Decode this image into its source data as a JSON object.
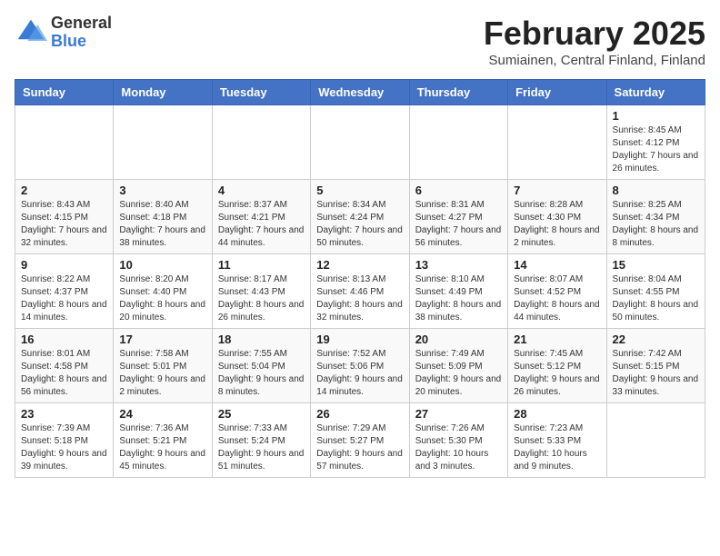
{
  "header": {
    "logo_general": "General",
    "logo_blue": "Blue",
    "month_title": "February 2025",
    "location": "Sumiainen, Central Finland, Finland"
  },
  "weekdays": [
    "Sunday",
    "Monday",
    "Tuesday",
    "Wednesday",
    "Thursday",
    "Friday",
    "Saturday"
  ],
  "weeks": [
    [
      null,
      null,
      null,
      null,
      null,
      null,
      {
        "day": "1",
        "sunrise": "Sunrise: 8:45 AM",
        "sunset": "Sunset: 4:12 PM",
        "daylight": "Daylight: 7 hours and 26 minutes."
      }
    ],
    [
      {
        "day": "2",
        "sunrise": "Sunrise: 8:43 AM",
        "sunset": "Sunset: 4:15 PM",
        "daylight": "Daylight: 7 hours and 32 minutes."
      },
      {
        "day": "3",
        "sunrise": "Sunrise: 8:40 AM",
        "sunset": "Sunset: 4:18 PM",
        "daylight": "Daylight: 7 hours and 38 minutes."
      },
      {
        "day": "4",
        "sunrise": "Sunrise: 8:37 AM",
        "sunset": "Sunset: 4:21 PM",
        "daylight": "Daylight: 7 hours and 44 minutes."
      },
      {
        "day": "5",
        "sunrise": "Sunrise: 8:34 AM",
        "sunset": "Sunset: 4:24 PM",
        "daylight": "Daylight: 7 hours and 50 minutes."
      },
      {
        "day": "6",
        "sunrise": "Sunrise: 8:31 AM",
        "sunset": "Sunset: 4:27 PM",
        "daylight": "Daylight: 7 hours and 56 minutes."
      },
      {
        "day": "7",
        "sunrise": "Sunrise: 8:28 AM",
        "sunset": "Sunset: 4:30 PM",
        "daylight": "Daylight: 8 hours and 2 minutes."
      },
      {
        "day": "8",
        "sunrise": "Sunrise: 8:25 AM",
        "sunset": "Sunset: 4:34 PM",
        "daylight": "Daylight: 8 hours and 8 minutes."
      }
    ],
    [
      {
        "day": "9",
        "sunrise": "Sunrise: 8:22 AM",
        "sunset": "Sunset: 4:37 PM",
        "daylight": "Daylight: 8 hours and 14 minutes."
      },
      {
        "day": "10",
        "sunrise": "Sunrise: 8:20 AM",
        "sunset": "Sunset: 4:40 PM",
        "daylight": "Daylight: 8 hours and 20 minutes."
      },
      {
        "day": "11",
        "sunrise": "Sunrise: 8:17 AM",
        "sunset": "Sunset: 4:43 PM",
        "daylight": "Daylight: 8 hours and 26 minutes."
      },
      {
        "day": "12",
        "sunrise": "Sunrise: 8:13 AM",
        "sunset": "Sunset: 4:46 PM",
        "daylight": "Daylight: 8 hours and 32 minutes."
      },
      {
        "day": "13",
        "sunrise": "Sunrise: 8:10 AM",
        "sunset": "Sunset: 4:49 PM",
        "daylight": "Daylight: 8 hours and 38 minutes."
      },
      {
        "day": "14",
        "sunrise": "Sunrise: 8:07 AM",
        "sunset": "Sunset: 4:52 PM",
        "daylight": "Daylight: 8 hours and 44 minutes."
      },
      {
        "day": "15",
        "sunrise": "Sunrise: 8:04 AM",
        "sunset": "Sunset: 4:55 PM",
        "daylight": "Daylight: 8 hours and 50 minutes."
      }
    ],
    [
      {
        "day": "16",
        "sunrise": "Sunrise: 8:01 AM",
        "sunset": "Sunset: 4:58 PM",
        "daylight": "Daylight: 8 hours and 56 minutes."
      },
      {
        "day": "17",
        "sunrise": "Sunrise: 7:58 AM",
        "sunset": "Sunset: 5:01 PM",
        "daylight": "Daylight: 9 hours and 2 minutes."
      },
      {
        "day": "18",
        "sunrise": "Sunrise: 7:55 AM",
        "sunset": "Sunset: 5:04 PM",
        "daylight": "Daylight: 9 hours and 8 minutes."
      },
      {
        "day": "19",
        "sunrise": "Sunrise: 7:52 AM",
        "sunset": "Sunset: 5:06 PM",
        "daylight": "Daylight: 9 hours and 14 minutes."
      },
      {
        "day": "20",
        "sunrise": "Sunrise: 7:49 AM",
        "sunset": "Sunset: 5:09 PM",
        "daylight": "Daylight: 9 hours and 20 minutes."
      },
      {
        "day": "21",
        "sunrise": "Sunrise: 7:45 AM",
        "sunset": "Sunset: 5:12 PM",
        "daylight": "Daylight: 9 hours and 26 minutes."
      },
      {
        "day": "22",
        "sunrise": "Sunrise: 7:42 AM",
        "sunset": "Sunset: 5:15 PM",
        "daylight": "Daylight: 9 hours and 33 minutes."
      }
    ],
    [
      {
        "day": "23",
        "sunrise": "Sunrise: 7:39 AM",
        "sunset": "Sunset: 5:18 PM",
        "daylight": "Daylight: 9 hours and 39 minutes."
      },
      {
        "day": "24",
        "sunrise": "Sunrise: 7:36 AM",
        "sunset": "Sunset: 5:21 PM",
        "daylight": "Daylight: 9 hours and 45 minutes."
      },
      {
        "day": "25",
        "sunrise": "Sunrise: 7:33 AM",
        "sunset": "Sunset: 5:24 PM",
        "daylight": "Daylight: 9 hours and 51 minutes."
      },
      {
        "day": "26",
        "sunrise": "Sunrise: 7:29 AM",
        "sunset": "Sunset: 5:27 PM",
        "daylight": "Daylight: 9 hours and 57 minutes."
      },
      {
        "day": "27",
        "sunrise": "Sunrise: 7:26 AM",
        "sunset": "Sunset: 5:30 PM",
        "daylight": "Daylight: 10 hours and 3 minutes."
      },
      {
        "day": "28",
        "sunrise": "Sunrise: 7:23 AM",
        "sunset": "Sunset: 5:33 PM",
        "daylight": "Daylight: 10 hours and 9 minutes."
      },
      null
    ]
  ]
}
